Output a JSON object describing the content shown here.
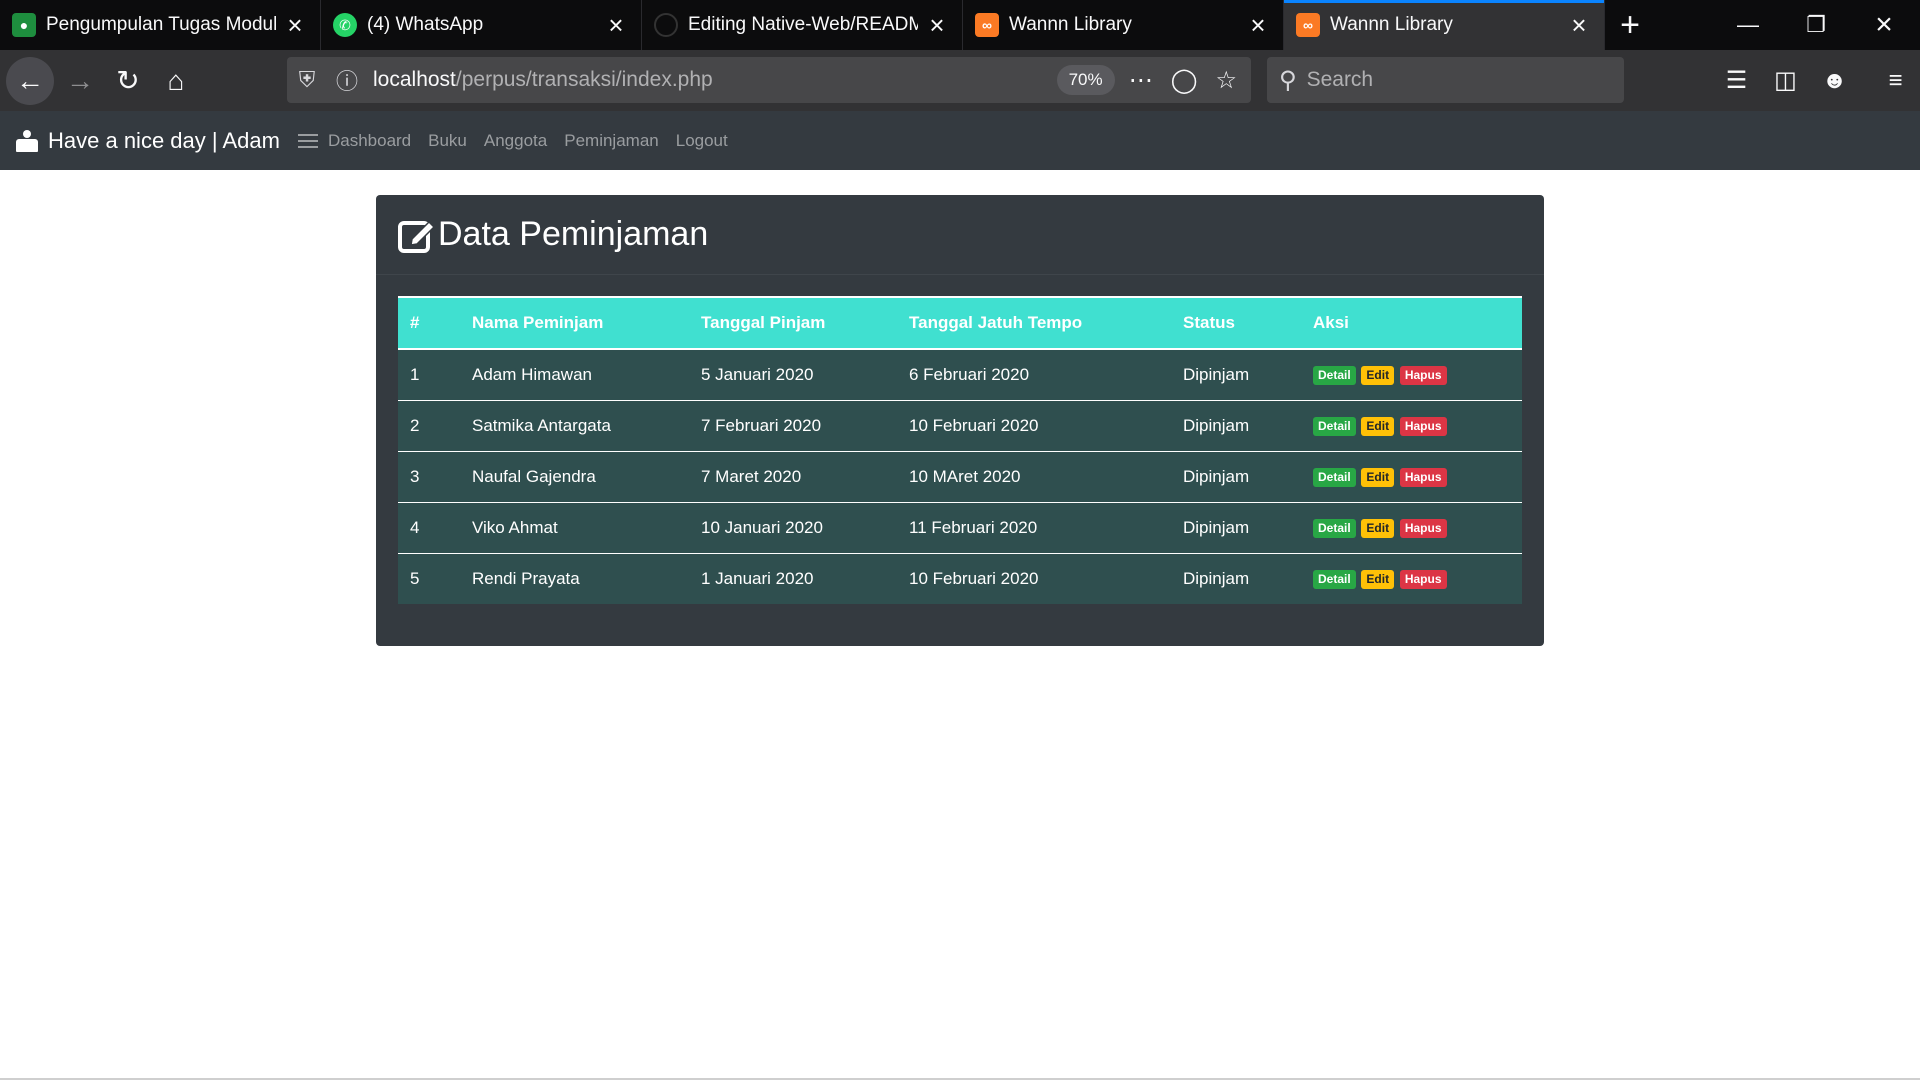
{
  "browser": {
    "tabs": [
      {
        "title": "Pengumpulan Tugas Modul U",
        "icon": "google-classroom-icon"
      },
      {
        "title": "(4) WhatsApp",
        "icon": "whatsapp-icon"
      },
      {
        "title": "Editing Native-Web/README",
        "icon": "github-icon"
      },
      {
        "title": "Wannn Library",
        "icon": "xampp-icon"
      },
      {
        "title": "Wannn Library",
        "icon": "xampp-icon",
        "active": true
      }
    ],
    "url": {
      "host": "localhost",
      "path": "/perpus/transaksi/index.php"
    },
    "zoom": "70%",
    "search_placeholder": "Search"
  },
  "app": {
    "brand": "Have a nice day | Adam",
    "nav": [
      "Dashboard",
      "Buku",
      "Anggota",
      "Peminjaman",
      "Logout"
    ]
  },
  "main": {
    "title": "Data Peminjaman",
    "table": {
      "headers": [
        "#",
        "Nama Peminjam",
        "Tanggal Pinjam",
        "Tanggal Jatuh Tempo",
        "Status",
        "Aksi"
      ],
      "rows": [
        {
          "no": "1",
          "nama": "Adam Himawan",
          "pinjam": "5 Januari 2020",
          "tempo": "6 Februari 2020",
          "status": "Dipinjam"
        },
        {
          "no": "2",
          "nama": "Satmika Antargata",
          "pinjam": "7 Februari 2020",
          "tempo": "10 Februari 2020",
          "status": "Dipinjam"
        },
        {
          "no": "3",
          "nama": "Naufal Gajendra",
          "pinjam": "7 Maret 2020",
          "tempo": "10 MAret 2020",
          "status": "Dipinjam"
        },
        {
          "no": "4",
          "nama": "Viko Ahmat",
          "pinjam": "10 Januari 2020",
          "tempo": "11 Februari 2020",
          "status": "Dipinjam"
        },
        {
          "no": "5",
          "nama": "Rendi Prayata",
          "pinjam": "1 Januari 2020",
          "tempo": "10 Februari 2020",
          "status": "Dipinjam"
        }
      ],
      "actions": {
        "detail": "Detail",
        "edit": "Edit",
        "hapus": "Hapus"
      }
    }
  },
  "colors": {
    "header_bg": "#40e0d0",
    "row_bg": "#2f4f4f",
    "card_bg": "#343a40",
    "detail": "#28a745",
    "edit": "#ffc107",
    "hapus": "#dc3545"
  }
}
